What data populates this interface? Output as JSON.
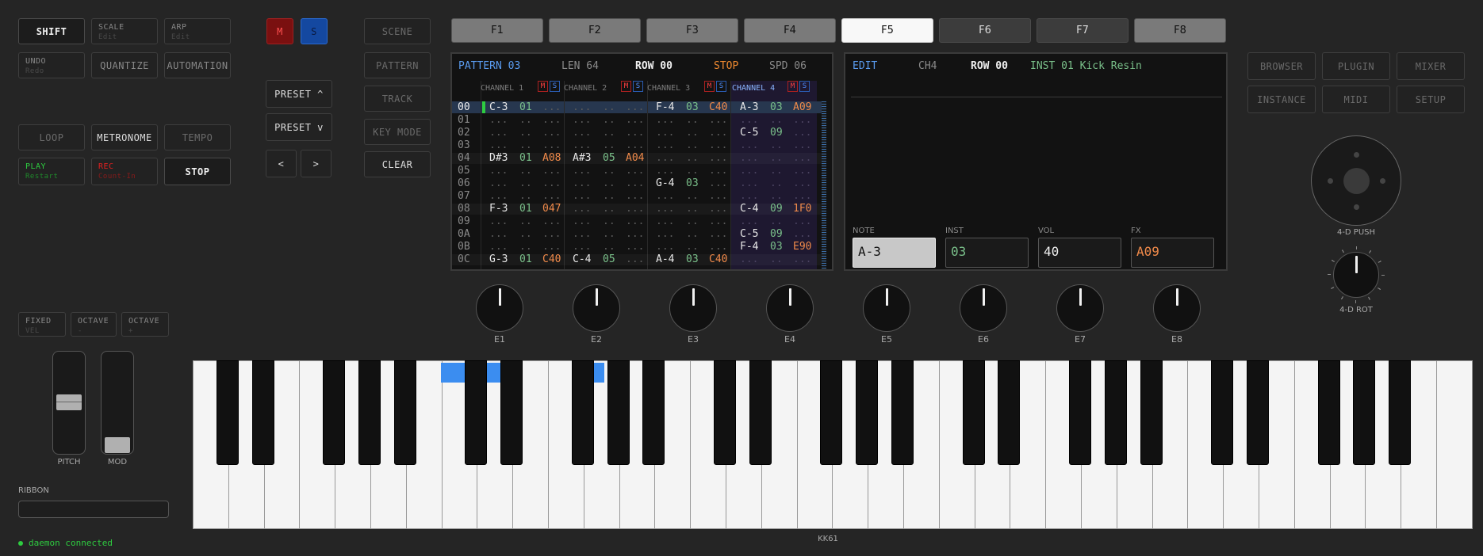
{
  "left_buttons": {
    "shift": "SHIFT",
    "scale": {
      "label": "SCALE",
      "sub": "Edit"
    },
    "arp": {
      "label": "ARP",
      "sub": "Edit"
    },
    "undo": {
      "label": "UNDO",
      "sub": "Redo"
    },
    "quantize": "QUANTIZE",
    "automation": "AUTOMATION",
    "loop": "LOOP",
    "metronome": "METRONOME",
    "tempo": "TEMPO",
    "play": {
      "label": "PLAY",
      "sub": "Restart"
    },
    "rec": {
      "label": "REC",
      "sub": "Count-In"
    },
    "stop": "STOP",
    "fixed": {
      "label": "FIXED",
      "sub": "VEL"
    },
    "octave_down": {
      "label": "OCTAVE",
      "sub": "-"
    },
    "octave_up": {
      "label": "OCTAVE",
      "sub": "+"
    }
  },
  "ms_buttons": {
    "m": "M",
    "s": "S"
  },
  "preset": {
    "up": "PRESET ^",
    "down": "PRESET v",
    "prev": "<",
    "next": ">"
  },
  "mode_buttons": [
    "SCENE",
    "PATTERN",
    "TRACK",
    "KEY MODE",
    "CLEAR"
  ],
  "fkeys": [
    "F1",
    "F2",
    "F3",
    "F4",
    "F5",
    "F6",
    "F7",
    "F8"
  ],
  "active_fkey": "F5",
  "right_buttons": [
    "BROWSER",
    "PLUGIN",
    "MIXER",
    "INSTANCE",
    "MIDI",
    "SETUP"
  ],
  "pattern": {
    "name": "PATTERN 03",
    "len": "LEN 64",
    "row": "ROW 00",
    "state": "STOP",
    "speed": "SPD 06",
    "channels": [
      "CHANNEL 1",
      "CHANNEL 2",
      "CHANNEL 3",
      "CHANNEL 4"
    ],
    "rows": [
      {
        "n": "00",
        "c": [
          [
            "C-3",
            "01",
            "..."
          ],
          [
            "...",
            "..",
            "..."
          ],
          [
            "F-4",
            "03",
            "C40"
          ],
          [
            "A-3",
            "03",
            "A09"
          ]
        ]
      },
      {
        "n": "01",
        "c": [
          [
            "...",
            "..",
            "..."
          ],
          [
            "...",
            "..",
            "..."
          ],
          [
            "...",
            "..",
            "..."
          ],
          [
            "...",
            "..",
            "..."
          ]
        ]
      },
      {
        "n": "02",
        "c": [
          [
            "...",
            "..",
            "..."
          ],
          [
            "...",
            "..",
            "..."
          ],
          [
            "...",
            "..",
            "..."
          ],
          [
            "C-5",
            "09",
            "..."
          ]
        ]
      },
      {
        "n": "03",
        "c": [
          [
            "...",
            "..",
            "..."
          ],
          [
            "...",
            "..",
            "..."
          ],
          [
            "...",
            "..",
            "..."
          ],
          [
            "...",
            "..",
            "..."
          ]
        ]
      },
      {
        "n": "04",
        "c": [
          [
            "D#3",
            "01",
            "A08"
          ],
          [
            "A#3",
            "05",
            "A04"
          ],
          [
            "...",
            "..",
            "..."
          ],
          [
            "...",
            "..",
            "..."
          ]
        ]
      },
      {
        "n": "05",
        "c": [
          [
            "...",
            "..",
            "..."
          ],
          [
            "...",
            "..",
            "..."
          ],
          [
            "...",
            "..",
            "..."
          ],
          [
            "...",
            "..",
            "..."
          ]
        ]
      },
      {
        "n": "06",
        "c": [
          [
            "...",
            "..",
            "..."
          ],
          [
            "...",
            "..",
            "..."
          ],
          [
            "G-4",
            "03",
            "..."
          ],
          [
            "...",
            "..",
            "..."
          ]
        ]
      },
      {
        "n": "07",
        "c": [
          [
            "...",
            "..",
            "..."
          ],
          [
            "...",
            "..",
            "..."
          ],
          [
            "...",
            "..",
            "..."
          ],
          [
            "...",
            "..",
            "..."
          ]
        ]
      },
      {
        "n": "08",
        "c": [
          [
            "F-3",
            "01",
            "047"
          ],
          [
            "...",
            "..",
            "..."
          ],
          [
            "...",
            "..",
            "..."
          ],
          [
            "C-4",
            "09",
            "1F0"
          ]
        ]
      },
      {
        "n": "09",
        "c": [
          [
            "...",
            "..",
            "..."
          ],
          [
            "...",
            "..",
            "..."
          ],
          [
            "...",
            "..",
            "..."
          ],
          [
            "...",
            "..",
            "..."
          ]
        ]
      },
      {
        "n": "0A",
        "c": [
          [
            "...",
            "..",
            "..."
          ],
          [
            "...",
            "..",
            "..."
          ],
          [
            "...",
            "..",
            "..."
          ],
          [
            "C-5",
            "09",
            "..."
          ]
        ]
      },
      {
        "n": "0B",
        "c": [
          [
            "...",
            "..",
            "..."
          ],
          [
            "...",
            "..",
            "..."
          ],
          [
            "...",
            "..",
            "..."
          ],
          [
            "F-4",
            "03",
            "E90"
          ]
        ]
      },
      {
        "n": "0C",
        "c": [
          [
            "G-3",
            "01",
            "C40"
          ],
          [
            "C-4",
            "05",
            "..."
          ],
          [
            "A-4",
            "03",
            "C40"
          ],
          [
            "...",
            "..",
            "..."
          ]
        ]
      }
    ]
  },
  "edit": {
    "mode": "EDIT",
    "channel": "CH4",
    "row": "ROW 00",
    "inst": "INST 01 Kick Resin",
    "fields": [
      {
        "label": "NOTE",
        "value": "A-3"
      },
      {
        "label": "INST",
        "value": "03"
      },
      {
        "label": "VOL",
        "value": "40"
      },
      {
        "label": "FX",
        "value": "A09"
      }
    ]
  },
  "encoders": [
    "E1",
    "E2",
    "E3",
    "E4",
    "E5",
    "E6",
    "E7",
    "E8"
  ],
  "push_label": "4-D PUSH",
  "rot_label": "4-D ROT",
  "pitch_label": "PITCH",
  "mod_label": "MOD",
  "ribbon_label": "RIBBON",
  "keyboard_label": "KK61",
  "status": "daemon connected",
  "colors": {
    "accent_blue": "#3b8df0",
    "note": "#e8e8e8",
    "inst": "#7ac08a",
    "fx": "#f08a4a",
    "stop": "#f08a30",
    "play": "#2ecc40",
    "rec": "#e02020"
  }
}
